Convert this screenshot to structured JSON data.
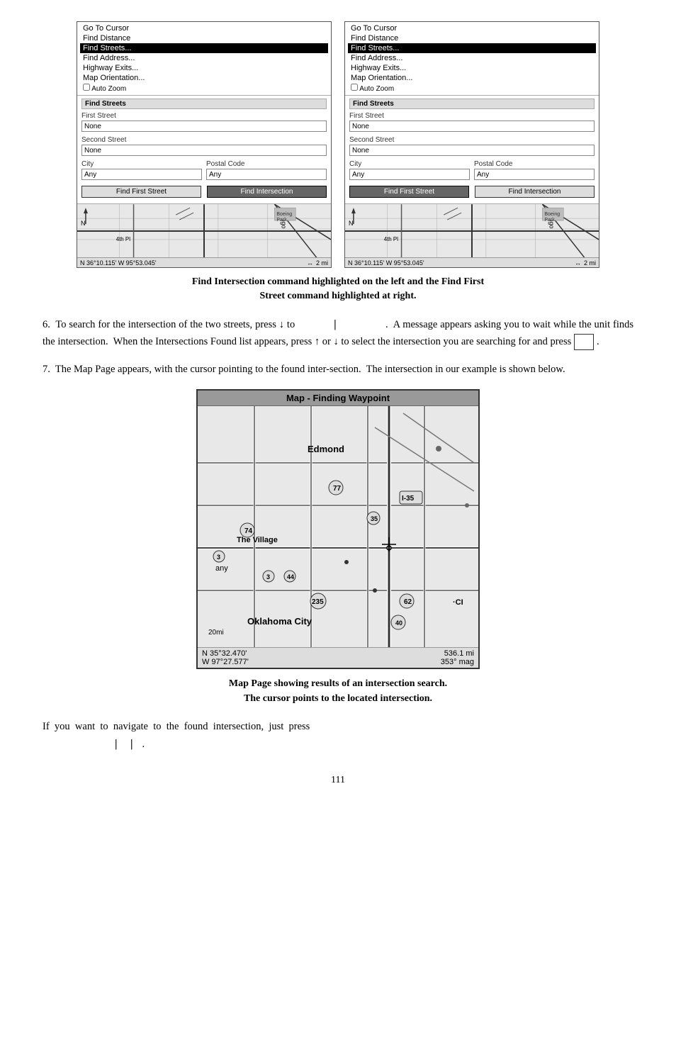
{
  "figures": {
    "left_panel": {
      "menu_items": [
        {
          "label": "Go To Cursor",
          "highlighted": false
        },
        {
          "label": "Find Distance",
          "highlighted": false
        },
        {
          "label": "Find Streets...",
          "highlighted": true
        },
        {
          "label": "Find Address...",
          "highlighted": false
        },
        {
          "label": "Highway Exits...",
          "highlighted": false
        },
        {
          "label": "Map Orientation...",
          "highlighted": false
        },
        {
          "label": "Auto Zoom",
          "highlighted": false
        }
      ],
      "section_label": "Find Streets",
      "first_street_label": "First Street",
      "first_street_value": "None",
      "second_street_label": "Second Street",
      "second_street_value": "None",
      "city_label": "City",
      "city_value": "Any",
      "postal_label": "Postal Code",
      "postal_value": "Any",
      "btn_first": "Find First Street",
      "btn_intersection": "Find Intersection",
      "btn_first_highlighted": false,
      "btn_intersection_highlighted": true,
      "map_label": "Mingo",
      "street_label": "4th Pl",
      "coords": "N  36°10.115'  W  95°53.045'",
      "scale": "2 mi",
      "arrow": "↔"
    },
    "right_panel": {
      "menu_items": [
        {
          "label": "Go To Cursor",
          "highlighted": false
        },
        {
          "label": "Find Distance",
          "highlighted": false
        },
        {
          "label": "Find Streets...",
          "highlighted": true
        },
        {
          "label": "Find Address...",
          "highlighted": false
        },
        {
          "label": "Highway Exits...",
          "highlighted": false
        },
        {
          "label": "Map Orientation...",
          "highlighted": false
        },
        {
          "label": "Auto Zoom",
          "highlighted": false
        }
      ],
      "section_label": "Find Streets",
      "first_street_label": "First Street",
      "first_street_value": "None",
      "second_street_label": "Second Street",
      "second_street_value": "None",
      "city_label": "City",
      "city_value": "Any",
      "postal_label": "Postal Code",
      "postal_value": "Any",
      "btn_first": "Find First Street",
      "btn_intersection": "Find Intersection",
      "btn_first_highlighted": true,
      "btn_intersection_highlighted": false,
      "street_label": "4th Pl",
      "coords": "N  36°10.115'  W  95°53.045'",
      "scale": "2 mi",
      "arrow": "↔"
    },
    "caption": "Find Intersection command highlighted on the left and the Find First\nStreet command highlighted at right."
  },
  "paragraphs": {
    "para6": "6.  To search for the intersection of the two streets, press ↓ to\n|    .  A message appears asking you to wait while the unit\nfinds the intersection.  When the Intersections Found list appears, press\n↑ or ↓ to select the intersection you are searching for and press      .",
    "para7": "7.  The Map Page appears, with the cursor pointing to the found inter-\nsection.  The intersection in our example is shown below."
  },
  "big_map": {
    "title": "Map - Finding Waypoint",
    "places": [
      {
        "name": "Edmond"
      },
      {
        "name": "77"
      },
      {
        "name": "74"
      },
      {
        "name": "I-35"
      },
      {
        "name": "35"
      },
      {
        "name": "The Village"
      },
      {
        "name": "3"
      },
      {
        "name": "44"
      },
      {
        "name": "any"
      },
      {
        "name": "3"
      },
      {
        "name": "44"
      },
      {
        "name": "235"
      },
      {
        "name": "62"
      },
      {
        "name": "Oklahoma City"
      },
      {
        "name": "20mi"
      },
      {
        "name": "40"
      },
      {
        "name": "CI"
      }
    ],
    "status": {
      "line1_left": "N  35°32.470'",
      "line1_right": "536.1 mi",
      "line2_left": "W  97°27.577'",
      "line2_right": "353° mag"
    }
  },
  "map_caption": "Map Page showing results of an intersection search.\nThe cursor points to the located intersection.",
  "final_para": "If  you  want  to  navigate  to  the  found  intersection,  just  press\n|    |    .",
  "page_number": "111"
}
